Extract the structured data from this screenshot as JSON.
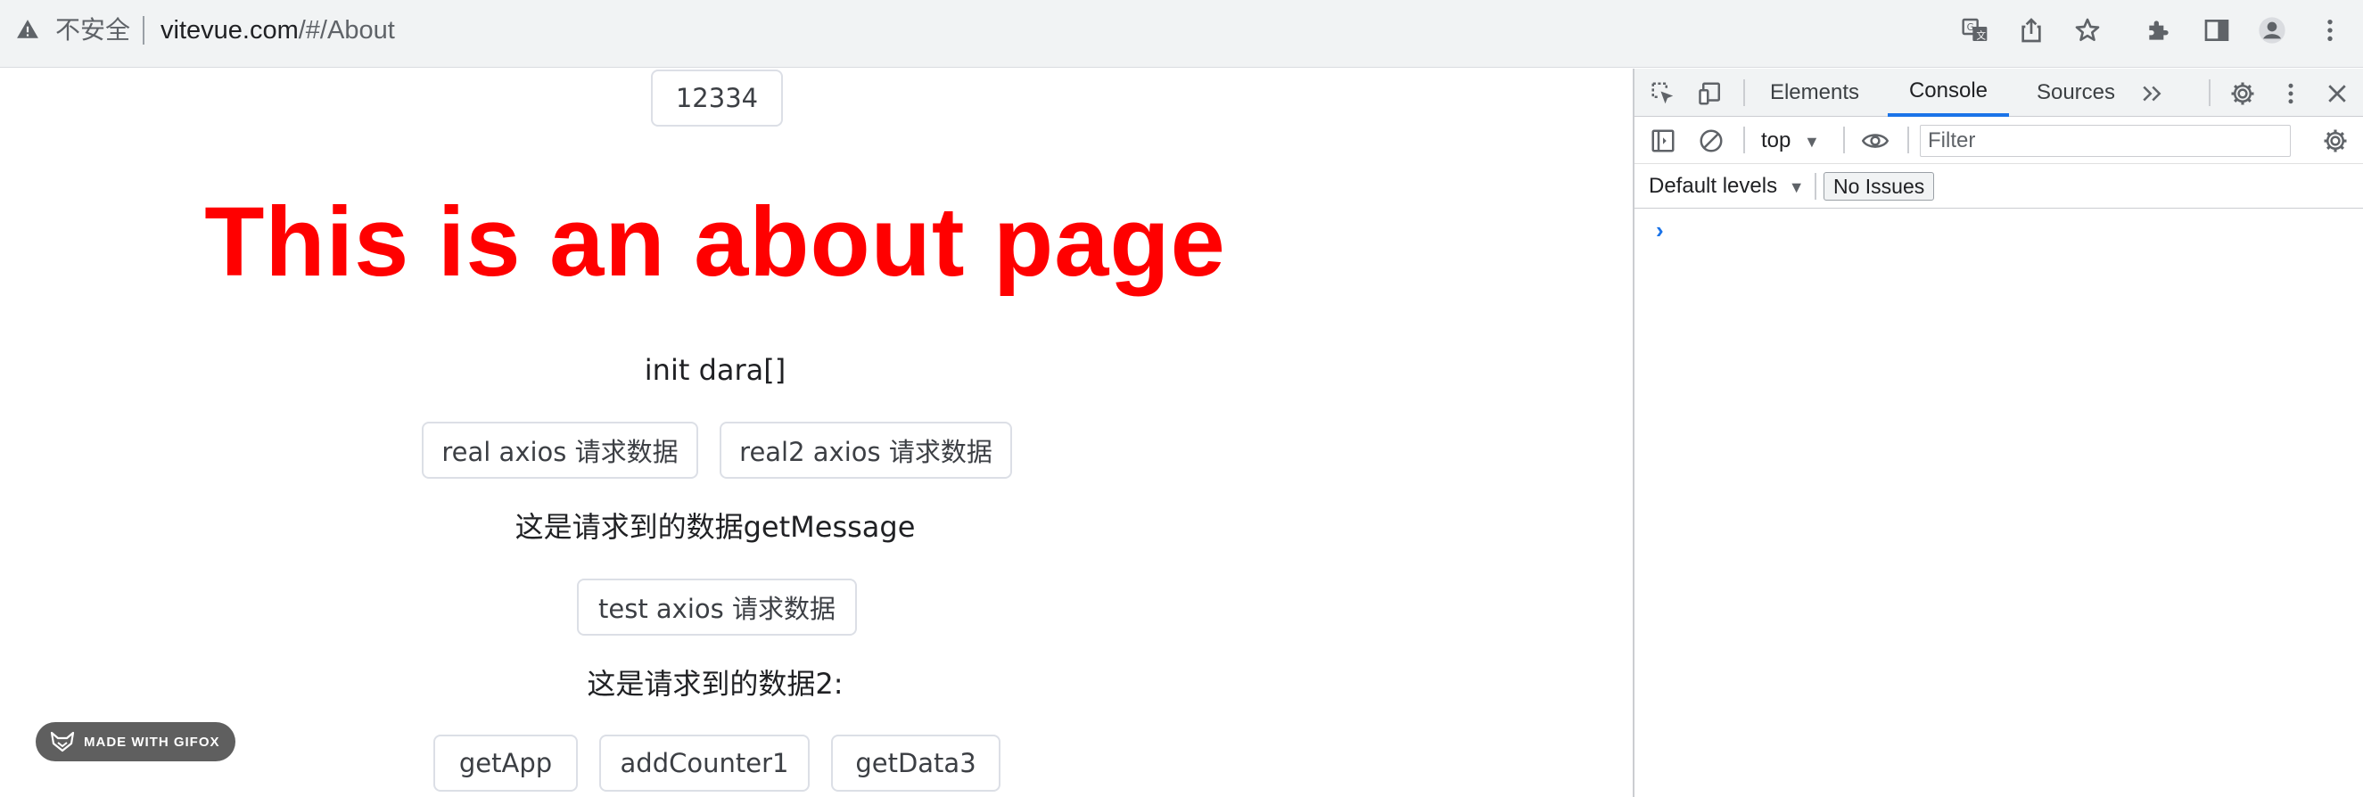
{
  "browser": {
    "security_label": "不安全",
    "url_host": "vitevue.com",
    "url_path": "/#/About",
    "toolbar_icons": [
      "translate-icon",
      "share-icon",
      "star-icon",
      "extensions-icon",
      "side-panel-icon",
      "profile-icon",
      "menu-icon"
    ]
  },
  "page": {
    "top_button": "12334",
    "heading": "This is an about page",
    "init_text": "init dara[]",
    "real_button": "real axios 请求数据",
    "real2_button": "real2 axios 请求数据",
    "message_text": "这是请求到的数据getMessage",
    "test_button": "test axios 请求数据",
    "data2_text": "这是请求到的数据2:",
    "bottom_buttons": [
      "getApp",
      "addCounter1",
      "getData3"
    ],
    "heading_color": "#ff0000"
  },
  "watermark": {
    "label": "MADE WITH GIFOX"
  },
  "devtools": {
    "tabs": [
      "Elements",
      "Console",
      "Sources"
    ],
    "active_tab": "Console",
    "context": "top",
    "filter_placeholder": "Filter",
    "levels": "Default levels",
    "issues": "No Issues",
    "prompt": "›",
    "accent_color": "#1a73e8"
  }
}
